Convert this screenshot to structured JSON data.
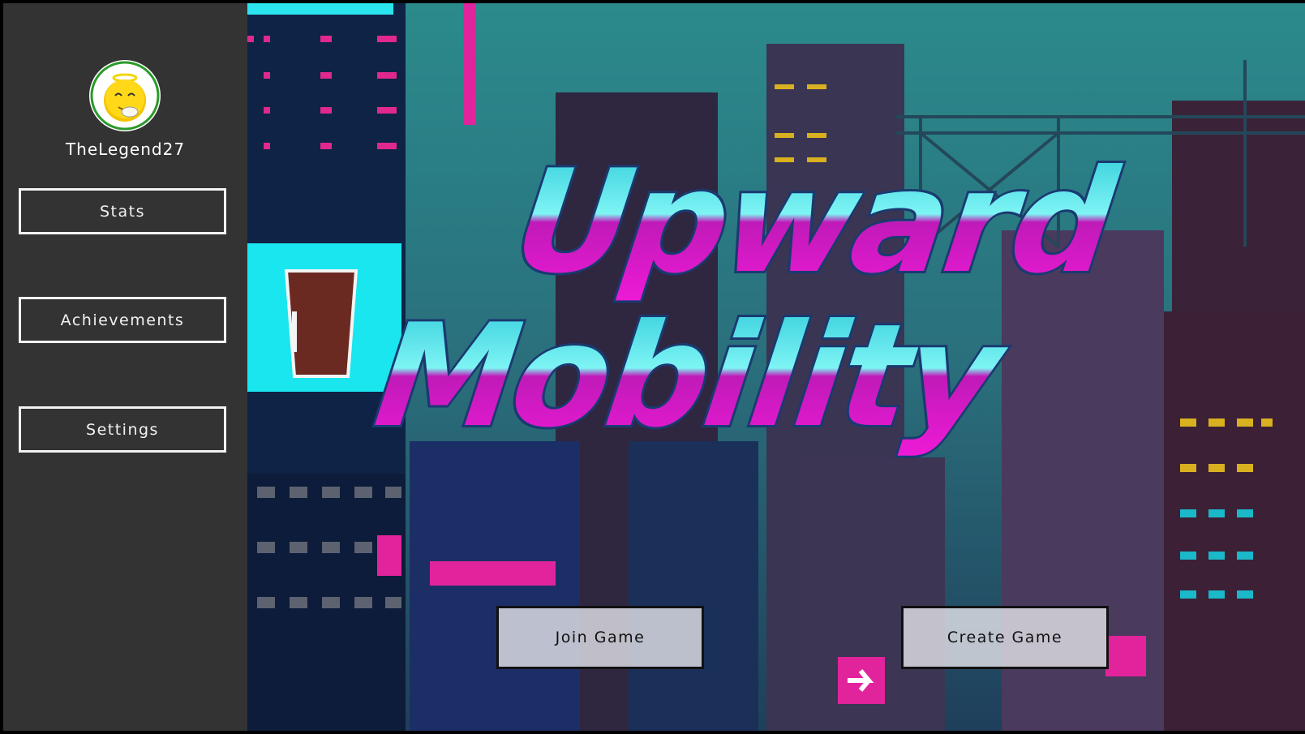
{
  "profile": {
    "username": "TheLegend27",
    "avatar_icon": "angel-emoji-icon"
  },
  "sidebar": {
    "items": [
      {
        "label": "Stats"
      },
      {
        "label": "Achievements"
      },
      {
        "label": "Settings"
      }
    ]
  },
  "game": {
    "title_line1": "Upward",
    "title_line2": "Mobility"
  },
  "actions": {
    "join_label": "Join Game",
    "create_label": "Create Game"
  },
  "colors": {
    "sidebar_bg": "#333333",
    "accent_cyan": "#38e8ee",
    "accent_magenta": "#e830c8",
    "sky_teal": "#2d8a8a"
  }
}
